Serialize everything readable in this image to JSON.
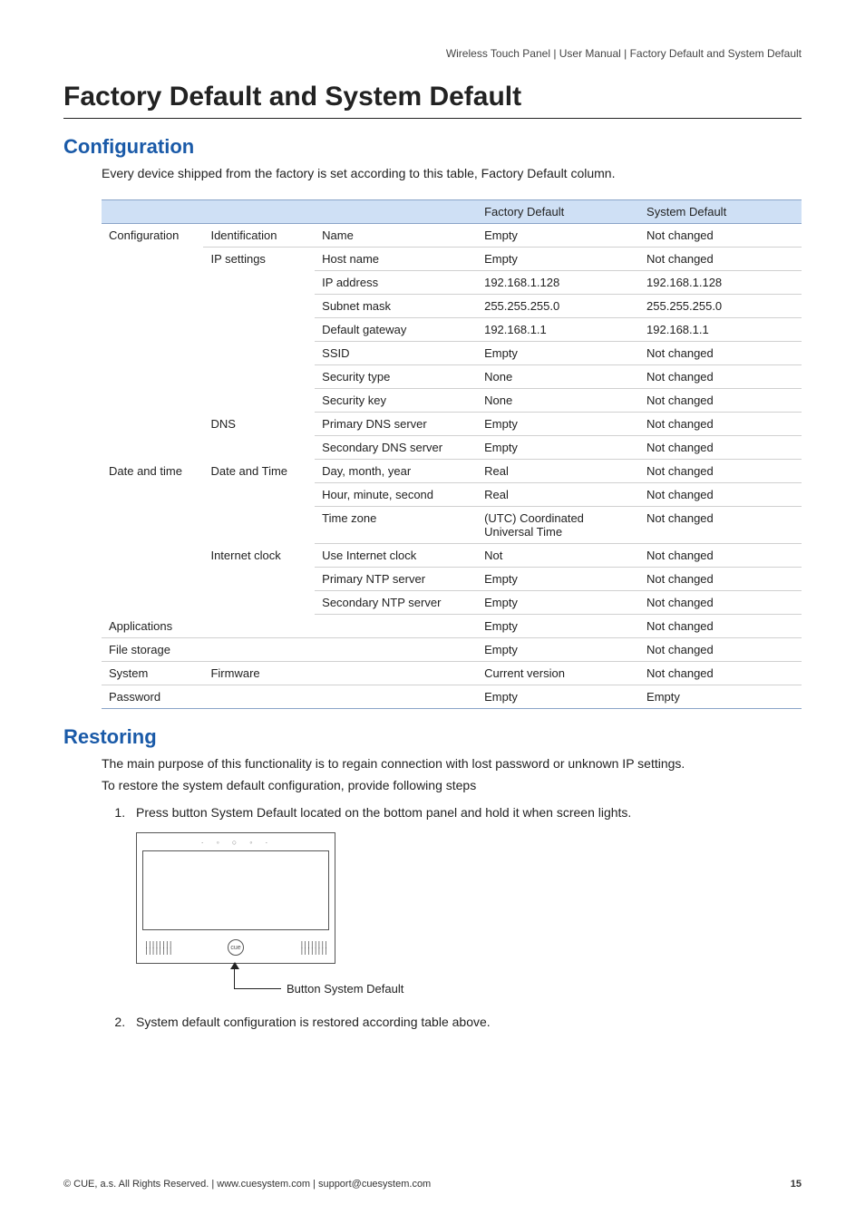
{
  "breadcrumb": "Wireless Touch Panel  |  User Manual  |  Factory Default and System Default",
  "h1": "Factory Default and System Default",
  "section_config": {
    "heading": "Configuration",
    "intro": "Every device shipped from the factory is set according to this table, Factory Default column.",
    "headers": {
      "c1": "",
      "c2": "",
      "c3": "",
      "c4": "Factory Default",
      "c5": "System Default"
    },
    "rows": [
      {
        "a": "Configuration",
        "b": "Identification",
        "c": "Name",
        "d": "Empty",
        "e": "Not changed",
        "a_rs": 10,
        "b_rs": 1
      },
      {
        "b": "IP settings",
        "c": "Host name",
        "d": "Empty",
        "e": "Not changed",
        "b_rs": 7
      },
      {
        "c": "IP address",
        "d": "192.168.1.128",
        "e": "192.168.1.128"
      },
      {
        "c": "Subnet mask",
        "d": "255.255.255.0",
        "e": "255.255.255.0"
      },
      {
        "c": "Default gateway",
        "d": "192.168.1.1",
        "e": "192.168.1.1"
      },
      {
        "c": "SSID",
        "d": "Empty",
        "e": "Not changed"
      },
      {
        "c": "Security type",
        "d": "None",
        "e": "Not changed"
      },
      {
        "c": "Security key",
        "d": "None",
        "e": "Not changed"
      },
      {
        "b": "DNS",
        "c": "Primary DNS server",
        "d": "Empty",
        "e": "Not changed",
        "b_rs": 2
      },
      {
        "c": "Secondary DNS server",
        "d": "Empty",
        "e": "Not changed"
      },
      {
        "a": "Date and time",
        "b": "Date and Time",
        "c": "Day, month, year",
        "d": "Real",
        "e": "Not changed",
        "a_rs": 6,
        "b_rs": 3
      },
      {
        "c": "Hour, minute, second",
        "d": "Real",
        "e": "Not changed"
      },
      {
        "c": "Time zone",
        "d": "(UTC) Coordinated Universal Time",
        "e": "Not changed"
      },
      {
        "b": "Internet clock",
        "c": "Use Internet clock",
        "d": "Not",
        "e": "Not changed",
        "b_rs": 3
      },
      {
        "c": "Primary NTP server",
        "d": "Empty",
        "e": "Not changed"
      },
      {
        "c": "Secondary NTP server",
        "d": "Empty",
        "e": "Not changed"
      },
      {
        "a": "Applications",
        "b": "",
        "c": "",
        "d": "Empty",
        "e": "Not changed",
        "a_rs": 1,
        "b_rs": 1
      },
      {
        "a": "File storage",
        "b": "",
        "c": "",
        "d": "Empty",
        "e": "Not changed",
        "a_rs": 1,
        "b_rs": 1
      },
      {
        "a": "System",
        "b": "Firmware",
        "c": "",
        "d": "Current version",
        "e": "Not changed",
        "a_rs": 1,
        "b_rs": 1
      },
      {
        "a": "Password",
        "b": "",
        "c": "",
        "d": "Empty",
        "e": "Empty",
        "a_rs": 1,
        "b_rs": 1
      }
    ]
  },
  "section_restoring": {
    "heading": "Restoring",
    "p1": "The main purpose of this functionality is to regain connection with lost password or unknown IP settings.",
    "p2": "To restore the system default configuration, provide following steps",
    "step1": "Press button System Default located on the bottom panel and hold it when screen lights.",
    "diagram_label": "Button System Default",
    "step2": "System default configuration is restored according table above."
  },
  "footer": {
    "left": "© CUE, a.s. All Rights Reserved.  |  www.cuesystem.com  |  support@cuesystem.com",
    "page": "15"
  }
}
